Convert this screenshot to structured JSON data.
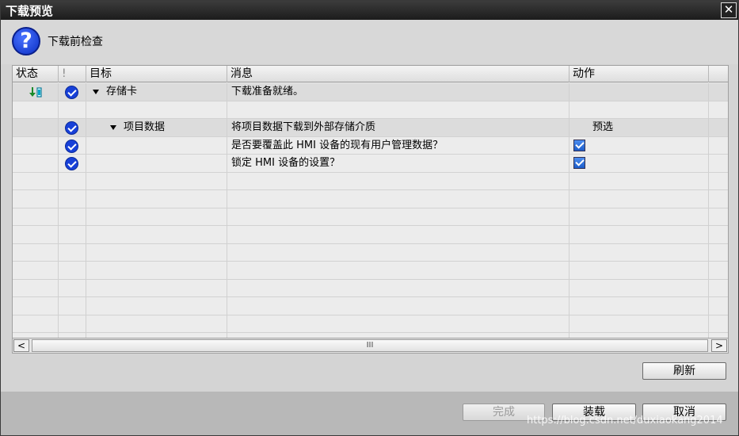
{
  "window": {
    "title": "下载预览",
    "close_glyph": "✕"
  },
  "header": {
    "icon": "question-icon",
    "icon_glyph": "?",
    "subtitle": "下载前检查"
  },
  "table": {
    "columns": [
      "状态",
      "!",
      "目标",
      "消息",
      "动作"
    ],
    "rows": [
      {
        "status_icon": "download-status-icon",
        "check": true,
        "expand": true,
        "target": "存储卡",
        "message": "下载准备就绪。",
        "action": "",
        "selected": true
      },
      {
        "status_icon": "",
        "check": false,
        "expand": false,
        "target": "",
        "message": "",
        "action": ""
      },
      {
        "status_icon": "",
        "check": true,
        "expand": true,
        "target": "项目数据",
        "message": "将项目数据下载到外部存储介质",
        "action": "预选",
        "selected": true
      },
      {
        "status_icon": "",
        "check": true,
        "expand": false,
        "target": "",
        "message": "是否要覆盖此 HMI 设备的现有用户管理数据？",
        "action_checkbox": true
      },
      {
        "status_icon": "",
        "check": true,
        "expand": false,
        "target": "",
        "message": "锁定 HMI 设备的设置？",
        "action_checkbox": true
      }
    ]
  },
  "scrollbar": {
    "left_arrow": "<",
    "right_arrow": ">",
    "thumb_grip": "III"
  },
  "buttons": {
    "refresh": "刷新",
    "done": "完成",
    "load": "装载",
    "cancel": "取消"
  },
  "watermark": "https://blog.csdn.net/duxiaokang2014",
  "colors": {
    "accent": "#1740d8",
    "titlebar": "#1c1c1c",
    "background": "#d4d4d4"
  }
}
